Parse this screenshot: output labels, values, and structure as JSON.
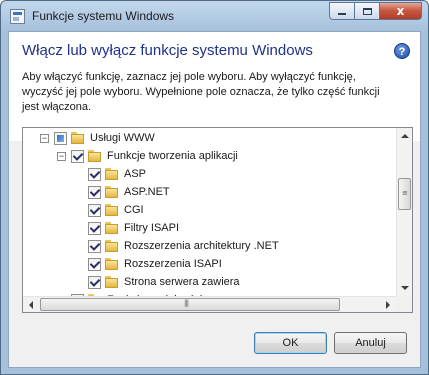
{
  "window": {
    "title": "Funkcje systemu Windows",
    "caption_close": "x"
  },
  "dialog": {
    "heading": "Włącz lub wyłącz funkcje systemu Windows",
    "help_glyph": "?",
    "description_lines": [
      "Aby włączyć funkcję, zaznacz jej pole wyboru. Aby wyłączyć funkcję,",
      "wyczyść jej pole wyboru. Wypełnione pole oznacza, że tylko część funkcji",
      "jest włączona."
    ]
  },
  "tree": {
    "items": [
      {
        "label": "Usługi WWW",
        "level": 0,
        "expander": "−",
        "state": "partial"
      },
      {
        "label": "Funkcje tworzenia aplikacji",
        "level": 1,
        "expander": "−",
        "state": "checked"
      },
      {
        "label": "ASP",
        "level": 2,
        "expander": "",
        "state": "checked"
      },
      {
        "label": "ASP.NET",
        "level": 2,
        "expander": "",
        "state": "checked"
      },
      {
        "label": "CGI",
        "level": 2,
        "expander": "",
        "state": "checked"
      },
      {
        "label": "Filtry ISAPI",
        "level": 2,
        "expander": "",
        "state": "checked"
      },
      {
        "label": "Rozszerzenia architektury .NET",
        "level": 2,
        "expander": "",
        "state": "checked"
      },
      {
        "label": "Rozszerzenia ISAPI",
        "level": 2,
        "expander": "",
        "state": "checked"
      },
      {
        "label": "Strona serwera zawiera",
        "level": 2,
        "expander": "",
        "state": "checked"
      },
      {
        "label": "Funkcje wydajnościowe",
        "level": 1,
        "expander": "+",
        "state": "partial"
      }
    ]
  },
  "buttons": {
    "ok": "OK",
    "cancel": "Anuluj"
  }
}
